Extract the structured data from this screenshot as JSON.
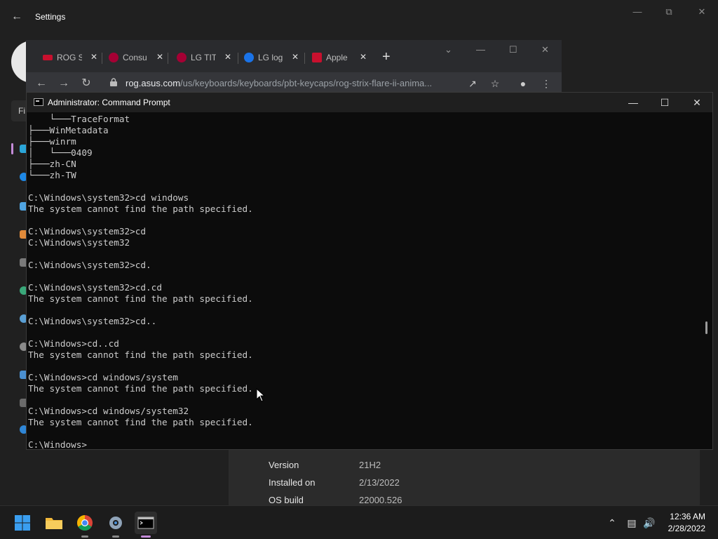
{
  "settings": {
    "title": "Settings",
    "search_placeholder": "Fi",
    "about": [
      {
        "label": "Version",
        "value": "21H2"
      },
      {
        "label": "Installed on",
        "value": "2/13/2022"
      },
      {
        "label": "OS build",
        "value": "22000.526"
      }
    ]
  },
  "chrome": {
    "tabs": [
      {
        "label": "ROG S",
        "favicon_color": "#c8102e"
      },
      {
        "label": "Consu",
        "favicon_color": "#a50034"
      },
      {
        "label": "LG TITL",
        "favicon_color": "#a50034"
      },
      {
        "label": "LG log",
        "favicon_color": "#1a73e8"
      },
      {
        "label": "Apple",
        "favicon_color": "#c8102e"
      }
    ],
    "url_host": "rog.asus.com",
    "url_path": "/us/keyboards/keyboards/pbt-keycaps/rog-strix-flare-ii-anima..."
  },
  "cmd": {
    "title": "Administrator: Command Prompt",
    "lines": [
      "    └───TraceFormat",
      "├───WinMetadata",
      "├───winrm",
      "│   └───0409",
      "├───zh-CN",
      "└───zh-TW",
      "",
      "C:\\Windows\\system32>cd windows",
      "The system cannot find the path specified.",
      "",
      "C:\\Windows\\system32>cd",
      "C:\\Windows\\system32",
      "",
      "C:\\Windows\\system32>cd.",
      "",
      "C:\\Windows\\system32>cd.cd",
      "The system cannot find the path specified.",
      "",
      "C:\\Windows\\system32>cd..",
      "",
      "C:\\Windows>cd..cd",
      "The system cannot find the path specified.",
      "",
      "C:\\Windows>cd windows/system",
      "The system cannot find the path specified.",
      "",
      "C:\\Windows>cd windows/system32",
      "The system cannot find the path specified.",
      "",
      "C:\\Windows>"
    ]
  },
  "taskbar": {
    "time": "12:36 AM",
    "date": "2/28/2022"
  },
  "colors": {
    "accent": "#c48bd8",
    "cmd_bg": "#0c0c0c",
    "cmd_text": "#cccccc"
  }
}
